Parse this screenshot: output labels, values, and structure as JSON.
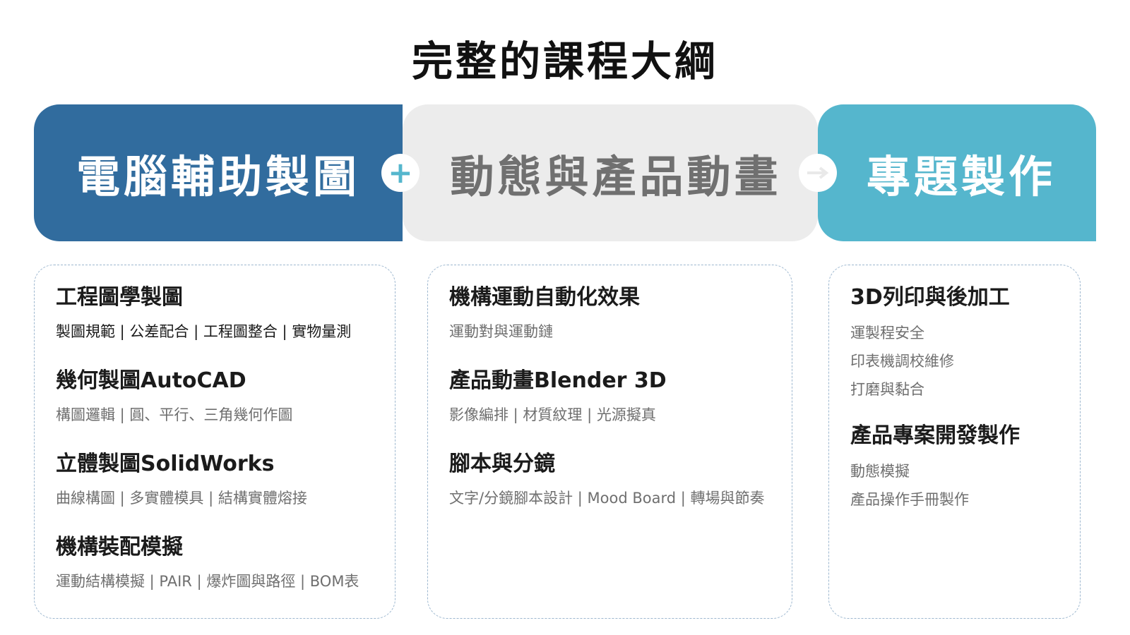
{
  "title": "完整的課程大綱",
  "stages": [
    {
      "label": "電腦輔助製圖",
      "color": "#316c9e"
    },
    {
      "label": "動態與產品動畫",
      "color": "#ececec"
    },
    {
      "label": "專題製作",
      "color": "#55b6cd"
    }
  ],
  "connectors": {
    "plus": "+",
    "arrow_icon": "arrow-right-icon"
  },
  "cards": [
    {
      "modules": [
        {
          "title": "工程圖學製圖",
          "subtitle": "製圖規範 | 公差配合 | 工程圖整合 | 實物量測"
        },
        {
          "title": "幾何製圖AutoCAD",
          "subtitle": "構圖邏輯 | 圓、平行、三角幾何作圖"
        },
        {
          "title": "立體製圖SolidWorks",
          "subtitle": "曲線構圖 | 多實體模具 | 結構實體熔接"
        },
        {
          "title": "機構裝配模擬",
          "subtitle": "運動結構模擬 | PAIR | 爆炸圖與路徑 | BOM表"
        }
      ]
    },
    {
      "modules": [
        {
          "title": "機構運動自動化效果",
          "subtitle": "運動對與運動鏈"
        },
        {
          "title": "產品動畫Blender 3D",
          "subtitle": "影像編排 | 材質紋理 | 光源擬真"
        },
        {
          "title": "腳本與分鏡",
          "subtitle": "文字/分鏡腳本設計 | Mood Board | 轉場與節奏"
        }
      ]
    },
    {
      "modules": [
        {
          "title": "3D列印與後加工",
          "items": [
            "運製程安全",
            "印表機調校維修",
            "打磨與黏合"
          ]
        },
        {
          "title": "產品專案開發製作",
          "items": [
            "動態模擬",
            "產品操作手冊製作"
          ]
        }
      ]
    }
  ]
}
